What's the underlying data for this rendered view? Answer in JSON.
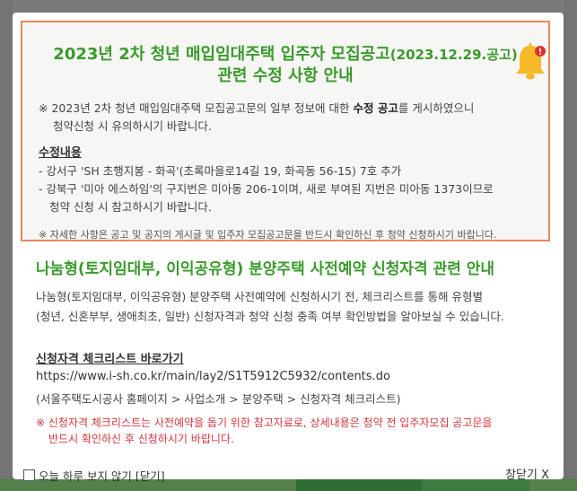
{
  "notice": {
    "title_line1": "2023년 2차 청년 매입임대주택 입주자 모집공고",
    "title_date": "(2023.12.29.공고)",
    "title_line2": "관련 수정 사항 안내",
    "intro_prefix": "※ 2023년 2차 청년 매입임대주택 모집공고문의 일부 정보에 대한 ",
    "intro_bold": "수정 공고",
    "intro_suffix": "를 게시하였으니",
    "intro_line2": "청약신청 시 유의하시기 바랍니다.",
    "section_title": "수정내용",
    "items": [
      "- 강서구 'SH 초행지봉 - 화곡'(초록마을로14길 19, 화곡동 56-15) 7호 추가",
      "- 강북구 '미아 에스하임'의 구지번은 미아동 206-1이며, 새로 부여된 지번은 미아동 1373이므로",
      "청약 신청 시 참고하시기 바랍니다."
    ],
    "footnote": "※ 자세한 사항은 공고 및 공지의 게시글 및 입주자 모집공고문을 반드시 확인하신 후 청약 신청하시기 바랍니다."
  },
  "sale": {
    "title": "나눔형(토지임대부, 이익공유형) 분양주택 사전예약 신청자격 관련 안내",
    "body_line1": "나눔형(토지임대부, 이익공유형) 분양주택 사전예약에 신청하시기 전, 체크리스트를 통해 유형별",
    "body_line2": "(청년, 신혼부부, 생애최초, 일반) 신청자격과 청약 신청 충족 여부 확인방법을 알아보실 수 있습니다.",
    "link_title": "신청자격 체크리스트 바로가기",
    "url": "https://www.i-sh.co.kr/main/lay2/S1T5912C5932/contents.do",
    "path": "(서울주택도시공사 홈페이지 > 사업소개 > 분양주택 > 신청자격 체크리스트)",
    "warn_line1": "※ 신청자격 체크리스트는 사전예약을 돕기 위한 참고자료로, 상세내용은 청약 전 입주자모집 공고문을",
    "warn_line2": "반드시 확인하신 후 신청하시기 바랍니다."
  },
  "footer": {
    "dont_show": "오늘 하루 보지 않기 [닫기]",
    "close": "창닫기 X"
  },
  "colors": {
    "title_green": "#3a9a2c",
    "notice_border": "#e9875a",
    "warn_red": "#d6363d"
  }
}
